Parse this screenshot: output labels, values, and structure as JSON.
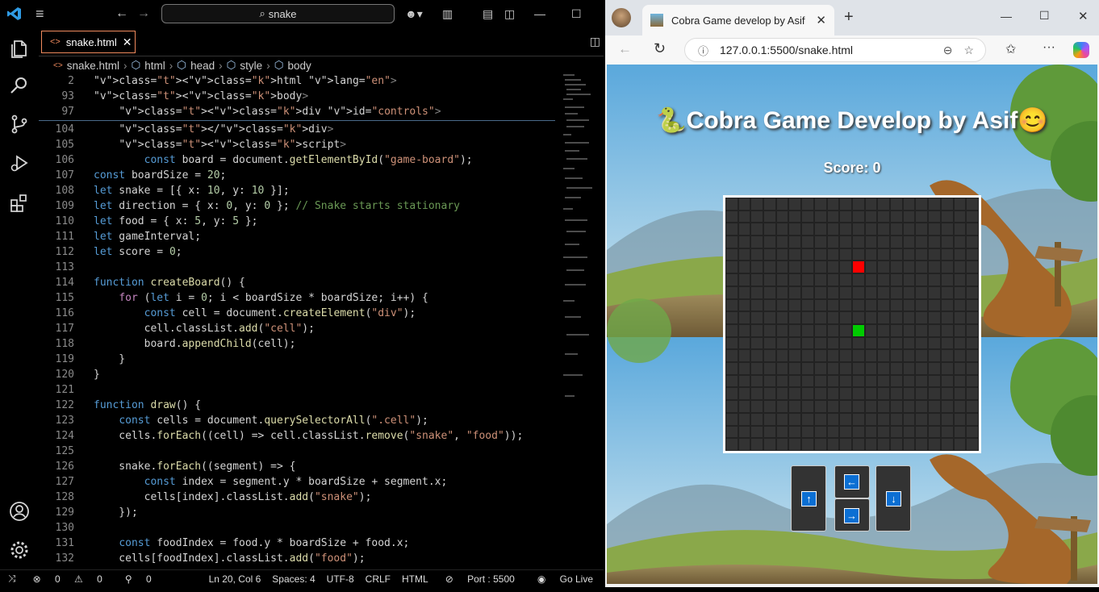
{
  "editor": {
    "search_text": "snake",
    "tab_label": "snake.html",
    "breadcrumb": [
      "snake.html",
      "html",
      "head",
      "style",
      "body"
    ],
    "lines": [
      {
        "n": "2",
        "t": "<html lang=\"en\">"
      },
      {
        "n": "93",
        "t": "<body>"
      },
      {
        "n": "97",
        "t": "    <div id=\"controls\">"
      },
      {
        "n": "104",
        "t": "    </div>"
      },
      {
        "n": "105",
        "t": "    <script>"
      },
      {
        "n": "106",
        "t": "        const board = document.getElementById(\"game-board\");"
      },
      {
        "n": "107",
        "t": "const boardSize = 20;"
      },
      {
        "n": "108",
        "t": "let snake = [{ x: 10, y: 10 }];"
      },
      {
        "n": "109",
        "t": "let direction = { x: 0, y: 0 }; // Snake starts stationary"
      },
      {
        "n": "110",
        "t": "let food = { x: 5, y: 5 };"
      },
      {
        "n": "111",
        "t": "let gameInterval;"
      },
      {
        "n": "112",
        "t": "let score = 0;"
      },
      {
        "n": "113",
        "t": ""
      },
      {
        "n": "114",
        "t": "function createBoard() {"
      },
      {
        "n": "115",
        "t": "    for (let i = 0; i < boardSize * boardSize; i++) {"
      },
      {
        "n": "116",
        "t": "        const cell = document.createElement(\"div\");"
      },
      {
        "n": "117",
        "t": "        cell.classList.add(\"cell\");"
      },
      {
        "n": "118",
        "t": "        board.appendChild(cell);"
      },
      {
        "n": "119",
        "t": "    }"
      },
      {
        "n": "120",
        "t": "}"
      },
      {
        "n": "121",
        "t": ""
      },
      {
        "n": "122",
        "t": "function draw() {"
      },
      {
        "n": "123",
        "t": "    const cells = document.querySelectorAll(\".cell\");"
      },
      {
        "n": "124",
        "t": "    cells.forEach((cell) => cell.classList.remove(\"snake\", \"food\"));"
      },
      {
        "n": "125",
        "t": ""
      },
      {
        "n": "126",
        "t": "    snake.forEach((segment) => {"
      },
      {
        "n": "127",
        "t": "        const index = segment.y * boardSize + segment.x;"
      },
      {
        "n": "128",
        "t": "        cells[index].classList.add(\"snake\");"
      },
      {
        "n": "129",
        "t": "    });"
      },
      {
        "n": "130",
        "t": ""
      },
      {
        "n": "131",
        "t": "    const foodIndex = food.y * boardSize + food.x;"
      },
      {
        "n": "132",
        "t": "    cells[foodIndex].classList.add(\"food\");"
      }
    ]
  },
  "status": {
    "errors": "0",
    "warnings": "0",
    "ports": "0",
    "position": "Ln 20, Col 6",
    "spaces": "Spaces: 4",
    "encoding": "UTF-8",
    "eol": "CRLF",
    "language": "HTML",
    "port": "Port : 5500",
    "golive": "Go Live"
  },
  "browser": {
    "tab_title": "Cobra Game develop by Asif",
    "url": "127.0.0.1:5500/snake.html"
  },
  "game": {
    "title": "Cobra Game Develop by Asif",
    "title_emoji_left": "🐍",
    "title_emoji_right": "😊",
    "score_label": "Score: 0",
    "grid_size": 20,
    "food_cell": {
      "x": 10,
      "y": 5
    },
    "snake_cell": {
      "x": 10,
      "y": 10
    },
    "up_arrow": "↑",
    "left_arrow": "←",
    "right_arrow": "→",
    "down_arrow": "↓"
  },
  "colors": {
    "accent": "#0b6fd3",
    "snake": "#00cc00",
    "food": "#ff0000",
    "tab_border": "#f08a5d"
  }
}
